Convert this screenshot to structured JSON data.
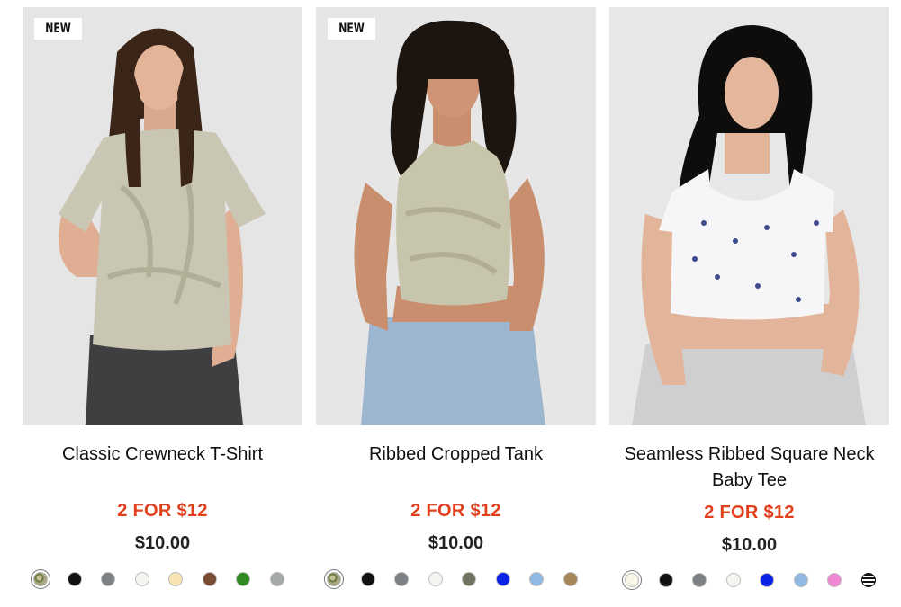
{
  "products": [
    {
      "badge": "NEW",
      "title": "Classic Crewneck T-Shirt",
      "promo": "2 FOR $12",
      "price": "$10.00",
      "shirt_color": "#c9c7b3",
      "swatches": [
        "camo",
        "#111111",
        "#7d8084",
        "#f4f4f0",
        "#f7e3b3",
        "#7a4b33",
        "#2f8b22",
        "#a4aaa8"
      ]
    },
    {
      "badge": "NEW",
      "title": "Ribbed Cropped Tank",
      "promo": "2 FOR $12",
      "price": "$10.00",
      "shirt_color": "#c7c6ad",
      "swatches": [
        "camo",
        "#111111",
        "#7d8084",
        "#f4f4f0",
        "#6f735f",
        "#0a22e6",
        "#8fb8e3",
        "#a48658"
      ]
    },
    {
      "badge": "",
      "title": "Seamless Ribbed Square Neck Baby Tee",
      "promo": "2 FOR $12",
      "price": "$10.00",
      "shirt_color": "#f6f6f8",
      "swatches": [
        "#f7f5e6",
        "#111111",
        "#7d8084",
        "#f4f4f0",
        "#0a22e6",
        "#8fb8e3",
        "#ee88d5",
        "stripe"
      ]
    }
  ]
}
